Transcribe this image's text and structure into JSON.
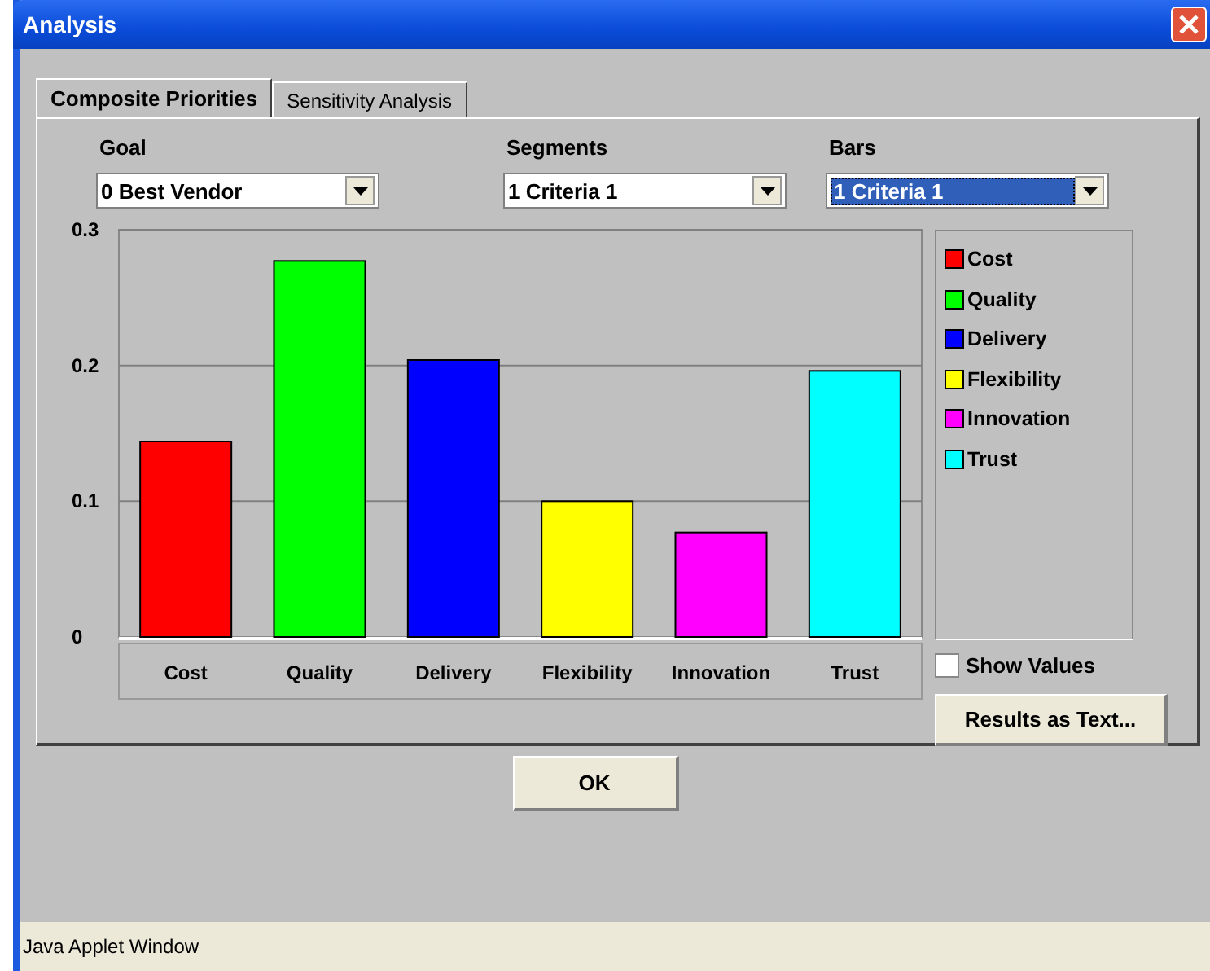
{
  "window": {
    "title": "Analysis"
  },
  "tabs": [
    {
      "label": "Composite Priorities",
      "selected": true
    },
    {
      "label": "Sensitivity Analysis",
      "selected": false
    }
  ],
  "selectors": [
    {
      "label": "Goal",
      "value": "0 Best Vendor",
      "focused": false
    },
    {
      "label": "Segments",
      "value": "1 Criteria 1",
      "focused": false
    },
    {
      "label": "Bars",
      "value": "1 Criteria 1",
      "focused": true
    }
  ],
  "chart_data": {
    "type": "bar",
    "categories": [
      "Cost",
      "Quality",
      "Delivery",
      "Flexibility",
      "Innovation",
      "Trust"
    ],
    "values": [
      0.144,
      0.277,
      0.204,
      0.1,
      0.077,
      0.196
    ],
    "ylim": [
      0,
      0.3
    ],
    "yticks": [
      0,
      0.1,
      0.2,
      0.3
    ]
  },
  "legend": [
    {
      "label": "Cost",
      "color": "#ff0000"
    },
    {
      "label": "Quality",
      "color": "#00ff00"
    },
    {
      "label": "Delivery",
      "color": "#0000ff"
    },
    {
      "label": "Flexibility",
      "color": "#ffff00"
    },
    {
      "label": "Innovation",
      "color": "#ff00ff"
    },
    {
      "label": "Trust",
      "color": "#00ffff"
    }
  ],
  "show_values": {
    "label": "Show Values",
    "checked": false
  },
  "results_button": "Results as Text...",
  "ok_button": "OK",
  "status_bar": "Java Applet Window"
}
